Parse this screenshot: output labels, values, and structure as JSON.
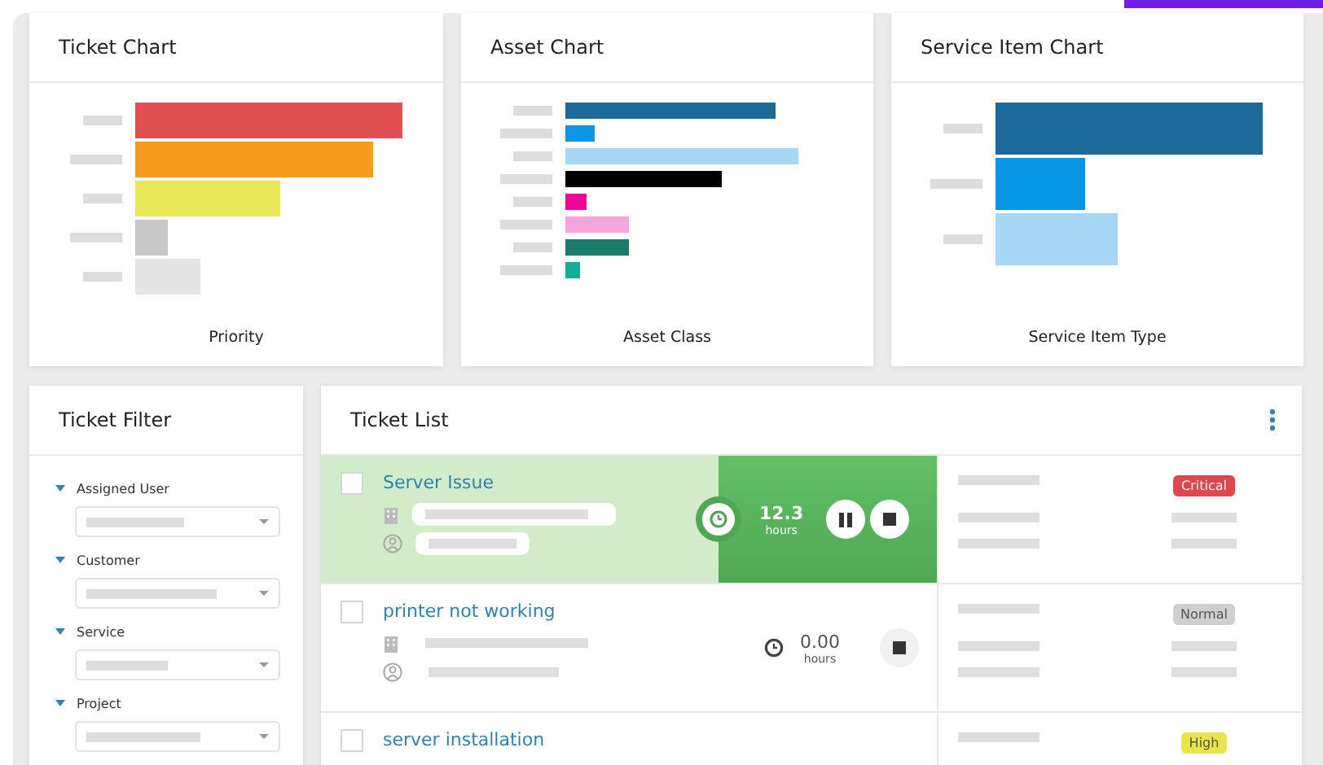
{
  "charts": [
    {
      "title": "Ticket Chart",
      "caption": "Priority",
      "kind": "priority"
    },
    {
      "title": "Asset Chart",
      "caption": "Asset Class",
      "kind": "asset"
    },
    {
      "title": "Service Item Chart",
      "caption": "Service Item Type",
      "kind": "service"
    }
  ],
  "filter": {
    "title": "Ticket Filter",
    "groups": [
      {
        "label": "Assigned User",
        "expanded": true
      },
      {
        "label": "Customer",
        "expanded": true
      },
      {
        "label": "Service",
        "expanded": true
      },
      {
        "label": "Project",
        "expanded": true
      }
    ]
  },
  "ticket_list": {
    "title": "Ticket List",
    "tickets": [
      {
        "title": "Server Issue",
        "selected": true,
        "checked": false,
        "running": true,
        "hours": "12.3",
        "unit": "hours",
        "priority": {
          "label": "Critical",
          "color": "#e0474c"
        }
      },
      {
        "title": "printer not working",
        "selected": false,
        "checked": false,
        "running": false,
        "hours": "0.00",
        "unit": "hours",
        "priority": {
          "label": "Normal",
          "color": "#cfcfcf"
        }
      },
      {
        "title": "server installation",
        "selected": false,
        "checked": false,
        "priority": {
          "label": "High",
          "color": "#e6e64a"
        }
      }
    ]
  }
}
